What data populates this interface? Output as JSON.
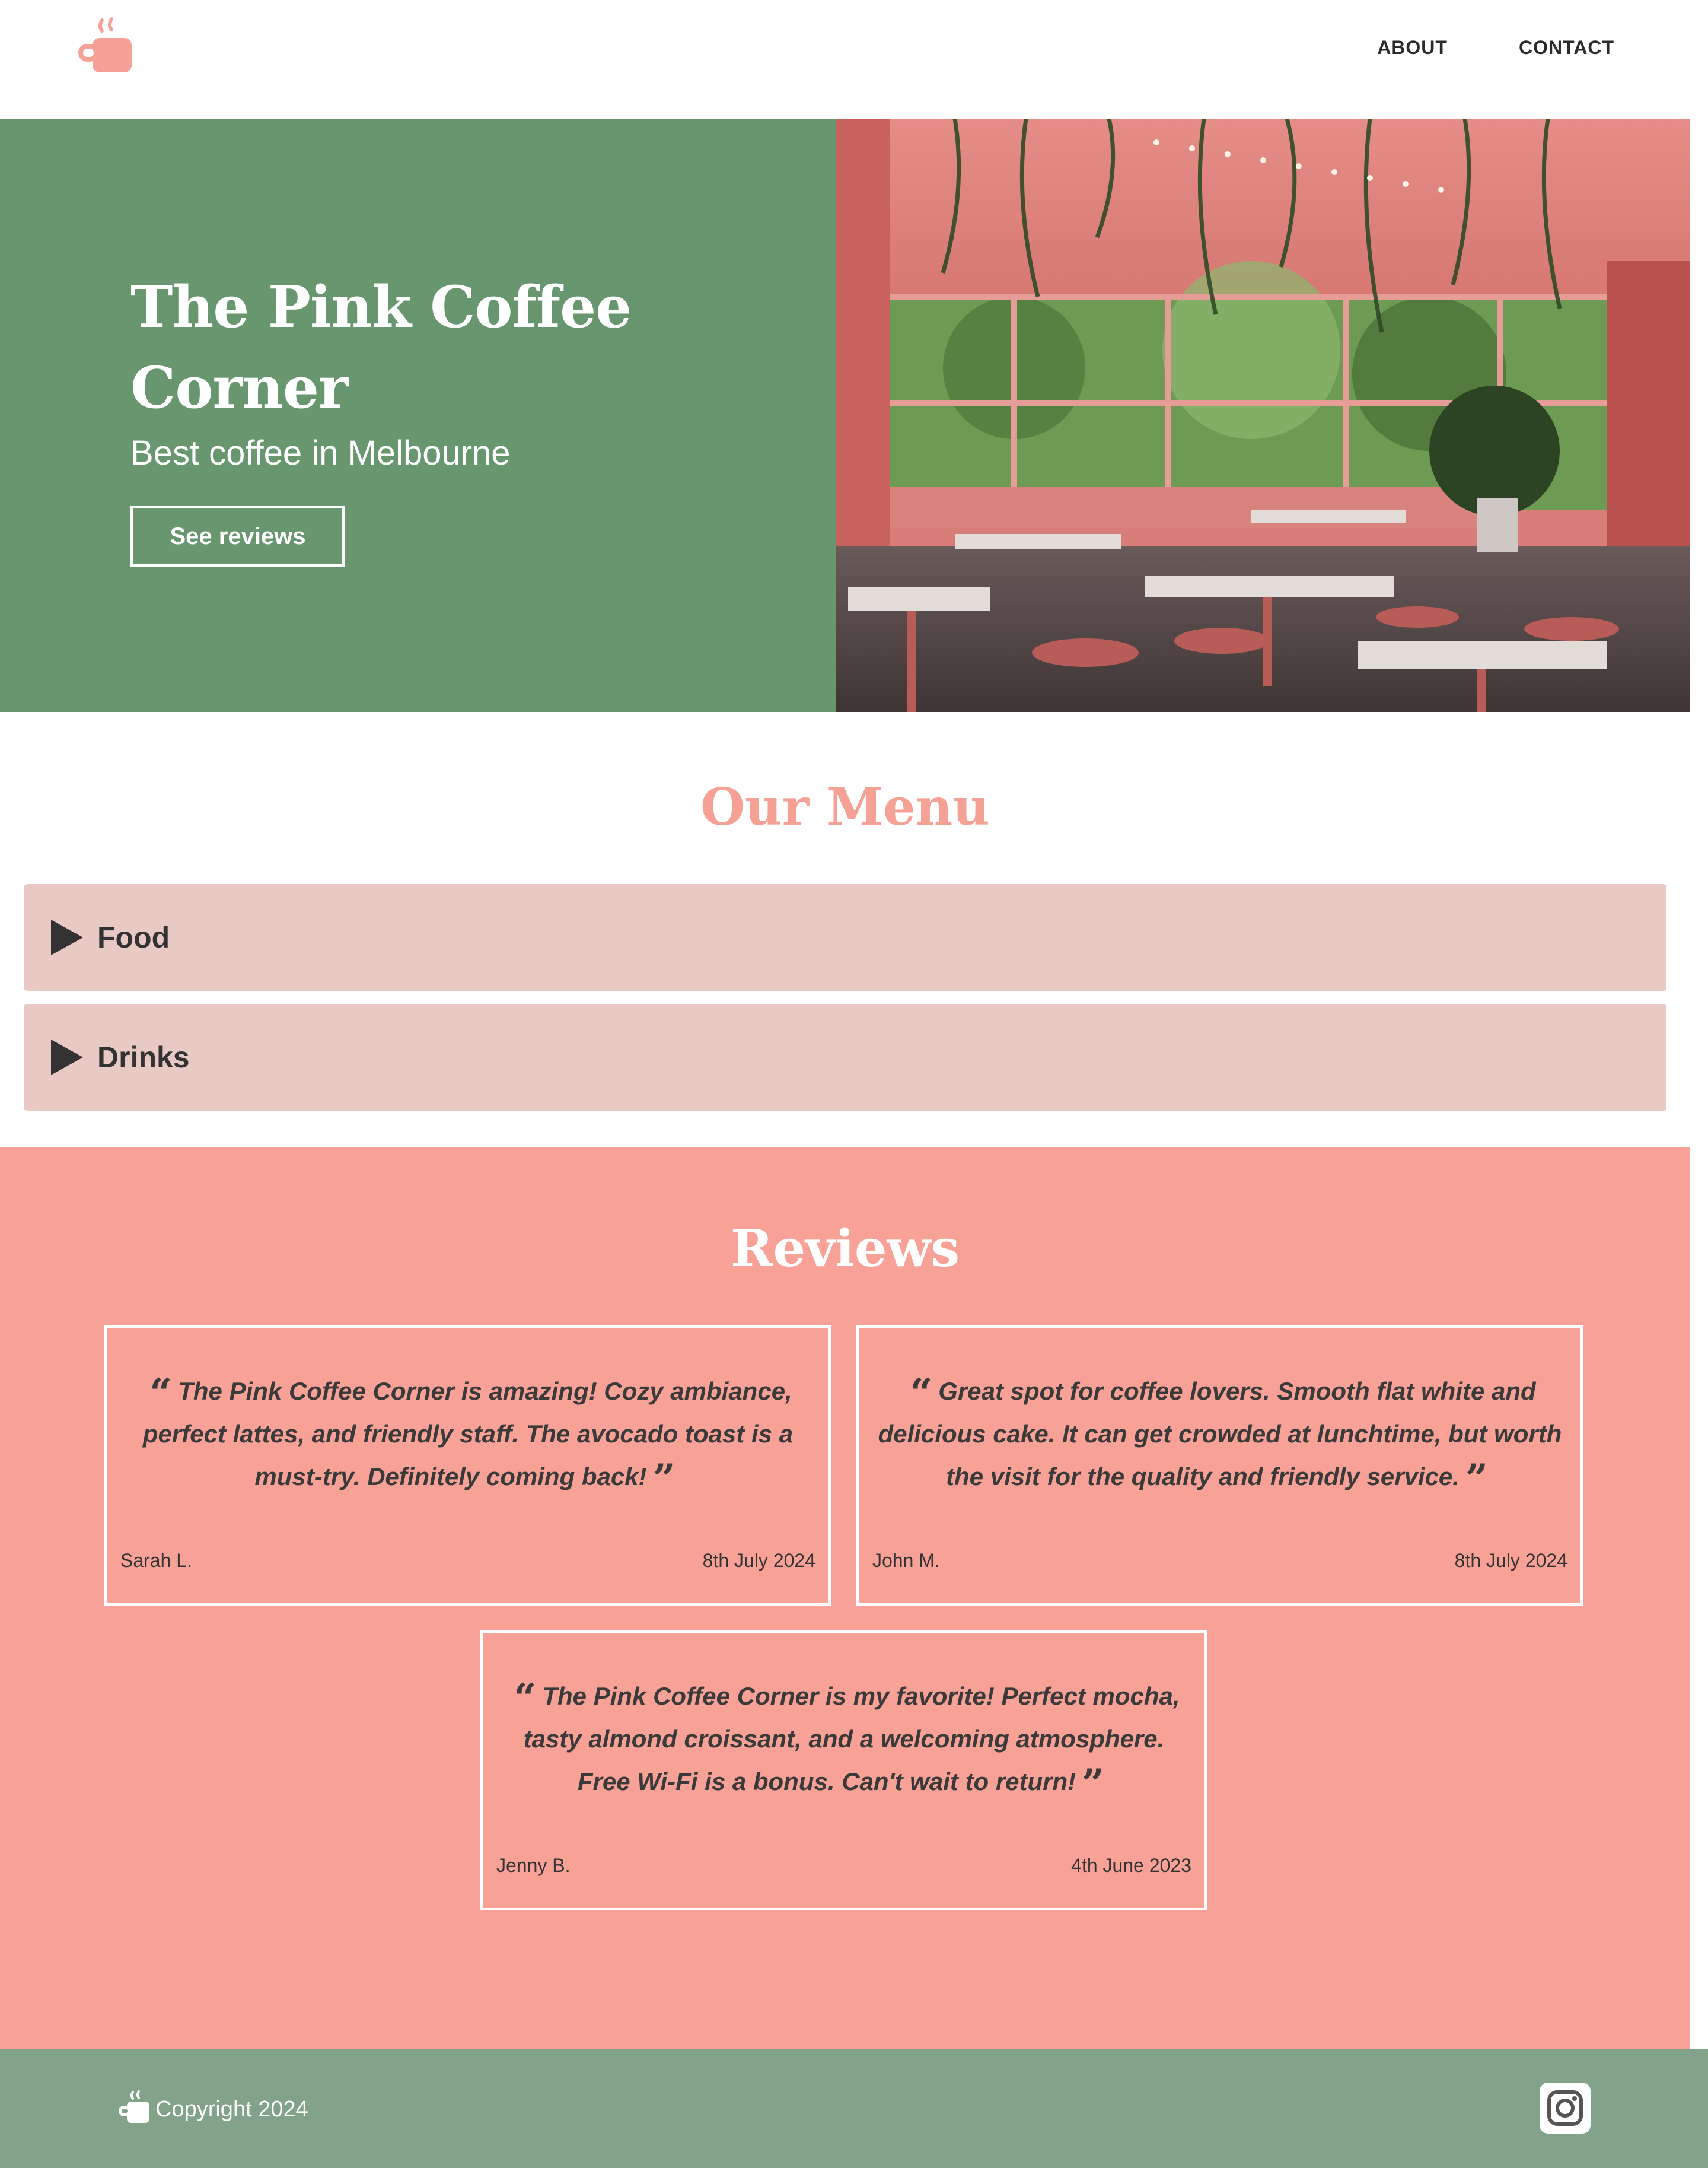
{
  "header": {
    "logo_icon": "coffee-cup-icon",
    "nav": [
      "ABOUT",
      "CONTACT"
    ]
  },
  "hero": {
    "title": "The Pink Coffee Corner",
    "subtitle": "Best coffee in Melbourne",
    "button": "See reviews",
    "image_icon": "cafe-interior-photo"
  },
  "menu": {
    "title": "Our Menu",
    "sections": [
      "Food",
      "Drinks"
    ]
  },
  "reviews": {
    "title": "Reviews",
    "items": [
      {
        "text": "The Pink Coffee Corner is amazing! Cozy ambiance, perfect lattes, and friendly staff. The avocado toast is a must-try. Definitely coming back!",
        "name": "Sarah L.",
        "date": "8th July 2024"
      },
      {
        "text": "Great spot for coffee lovers. Smooth flat white and delicious cake. It can get crowded at lunchtime, but worth the visit for the quality and friendly service.",
        "name": "John M.",
        "date": "8th July 2024"
      },
      {
        "text": "The Pink Coffee Corner is my favorite! Perfect mocha, tasty almond croissant, and a welcoming atmosphere. Free Wi-Fi is a bonus. Can't wait to return!",
        "name": "Jenny B.",
        "date": "4th June 2023"
      }
    ]
  },
  "footer": {
    "copyright": "Copyright 2024",
    "social_icon": "instagram-icon"
  },
  "colors": {
    "green": "#67966f",
    "pink": "#f7a197",
    "pink_light": "#e9c9c4",
    "footer_green": "#82a289"
  }
}
